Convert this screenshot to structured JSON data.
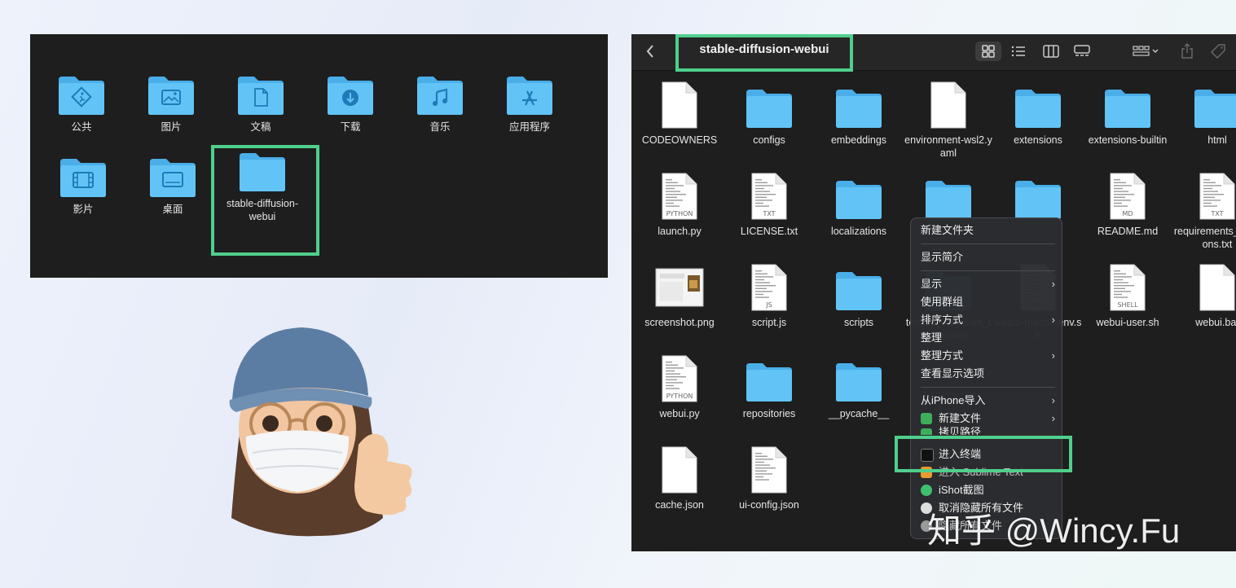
{
  "left_panel": {
    "items": [
      {
        "label": "公共",
        "icon": "public-folder-icon"
      },
      {
        "label": "图片",
        "icon": "pictures-folder-icon"
      },
      {
        "label": "文稿",
        "icon": "documents-folder-icon"
      },
      {
        "label": "下载",
        "icon": "downloads-folder-icon"
      },
      {
        "label": "音乐",
        "icon": "music-folder-icon"
      },
      {
        "label": "应用程序",
        "icon": "applications-folder-icon"
      },
      {
        "label": "影片",
        "icon": "movies-folder-icon"
      },
      {
        "label": "桌面",
        "icon": "desktop-folder-icon"
      },
      {
        "label": "stable-diffusion-webui",
        "icon": "folder-icon"
      }
    ]
  },
  "finder": {
    "title": "stable-diffusion-webui",
    "back_icon": "chevron-left-icon",
    "toolbar_icons": [
      "icon-view-icon",
      "list-view-icon",
      "column-view-icon",
      "gallery-view-icon",
      "group-icon",
      "share-icon",
      "tag-icon"
    ],
    "files": [
      {
        "label": "CODEOWNERS",
        "kind": "doc",
        "tag": ""
      },
      {
        "label": "configs",
        "kind": "folder",
        "tag": ""
      },
      {
        "label": "embeddings",
        "kind": "folder",
        "tag": ""
      },
      {
        "label": "environment-wsl2.yaml",
        "kind": "doc",
        "tag": ""
      },
      {
        "label": "extensions",
        "kind": "folder",
        "tag": ""
      },
      {
        "label": "extensions-builtin",
        "kind": "folder",
        "tag": ""
      },
      {
        "label": "html",
        "kind": "folder",
        "tag": ""
      },
      {
        "label": "launch.py",
        "kind": "code",
        "tag": "PYTHON"
      },
      {
        "label": "LICENSE.txt",
        "kind": "code",
        "tag": "TXT"
      },
      {
        "label": "localizations",
        "kind": "folder",
        "tag": ""
      },
      {
        "label": "",
        "kind": "folder",
        "tag": ""
      },
      {
        "label": "",
        "kind": "folder",
        "tag": ""
      },
      {
        "label": "README.md",
        "kind": "code",
        "tag": "MD"
      },
      {
        "label": "requirements_versions.txt",
        "kind": "code",
        "tag": "TXT"
      },
      {
        "label": "screenshot.png",
        "kind": "image",
        "tag": ""
      },
      {
        "label": "script.js",
        "kind": "code",
        "tag": "JS"
      },
      {
        "label": "scripts",
        "kind": "folder",
        "tag": ""
      },
      {
        "label": "textual_inversion_templates",
        "kind": "folder",
        "tag": ""
      },
      {
        "label": "webui-macos-env.sh",
        "kind": "code",
        "tag": "SHELL"
      },
      {
        "label": "webui-user.sh",
        "kind": "code",
        "tag": "SHELL"
      },
      {
        "label": "webui.bat",
        "kind": "doc",
        "tag": ""
      },
      {
        "label": "webui.py",
        "kind": "code",
        "tag": "PYTHON"
      },
      {
        "label": "repositories",
        "kind": "folder",
        "tag": ""
      },
      {
        "label": "__pycache__",
        "kind": "folder",
        "tag": ""
      },
      {
        "label": "cache.json",
        "kind": "doc",
        "tag": ""
      },
      {
        "label": "ui-config.json",
        "kind": "code",
        "tag": ""
      }
    ]
  },
  "context_menu": {
    "items": [
      {
        "label": "新建文件夹",
        "arrow": ""
      },
      {
        "label": "显示简介",
        "arrow": ""
      },
      {
        "label": "显示",
        "arrow": "›"
      },
      {
        "label": "使用群组",
        "arrow": ""
      },
      {
        "label": "排序方式",
        "arrow": "›"
      },
      {
        "label": "整理",
        "arrow": ""
      },
      {
        "label": "整理方式",
        "arrow": "›"
      },
      {
        "label": "查看显示选项",
        "arrow": ""
      },
      {
        "label": "从iPhone导入",
        "arrow": "›"
      },
      {
        "label": "新建文件",
        "arrow": "›"
      },
      {
        "label": "拷贝路径",
        "arrow": ""
      },
      {
        "label": "进入终端",
        "arrow": ""
      },
      {
        "label": "进入 Sublime Text",
        "arrow": ""
      },
      {
        "label": "iShot截图",
        "arrow": ""
      },
      {
        "label": "取消隐藏所有文件",
        "arrow": ""
      },
      {
        "label": "隐藏所有文件",
        "arrow": ""
      }
    ]
  },
  "watermark": "知乎 @Wincy.Fu",
  "colors": {
    "highlight": "#4fcf8c",
    "folder": "#5ec2f5",
    "panel": "#1e1e1e"
  }
}
